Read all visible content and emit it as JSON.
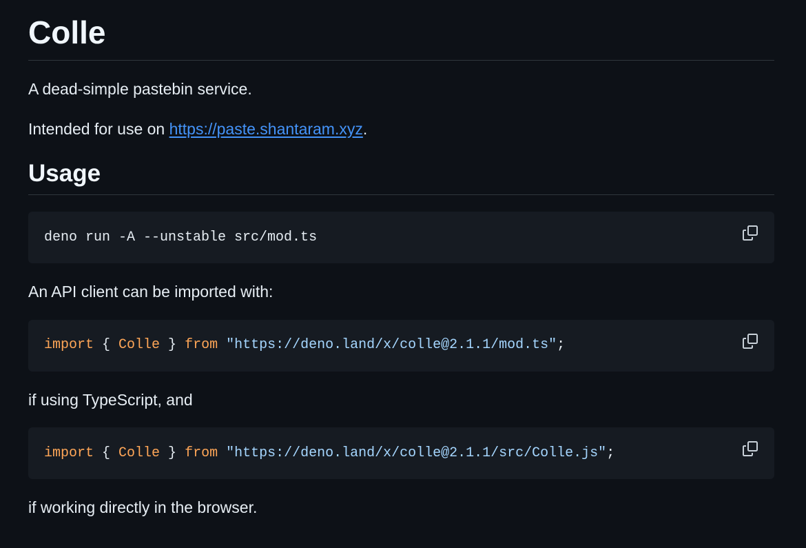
{
  "readme": {
    "title": "Colle",
    "description": "A dead-simple pastebin service.",
    "intended_prefix": "Intended for use on ",
    "intended_link": "https://paste.shantaram.xyz",
    "intended_suffix": ".",
    "usage_heading": "Usage",
    "code1": "deno run -A --unstable src/mod.ts",
    "api_text": "An API client can be imported with:",
    "code2": {
      "kw_import": "import",
      "brace_open": " { ",
      "ident": "Colle",
      "brace_close": " } ",
      "kw_from": "from",
      "space": " ",
      "url": "\"https://deno.land/x/colle@2.1.1/mod.ts\"",
      "semi": ";"
    },
    "ts_text": "if using TypeScript, and",
    "code3": {
      "kw_import": "import",
      "brace_open": " { ",
      "ident": "Colle",
      "brace_close": " } ",
      "kw_from": "from",
      "space": " ",
      "url": "\"https://deno.land/x/colle@2.1.1/src/Colle.js\"",
      "semi": ";"
    },
    "browser_text": "if working directly in the browser."
  },
  "icons": {
    "copy": "copy-icon"
  },
  "colors": {
    "background": "#0d1117",
    "code_background": "#161b22",
    "link": "#4493f8",
    "keyword": "#ff7b72",
    "identifier": "#ffa657",
    "string": "#a5d6ff"
  }
}
